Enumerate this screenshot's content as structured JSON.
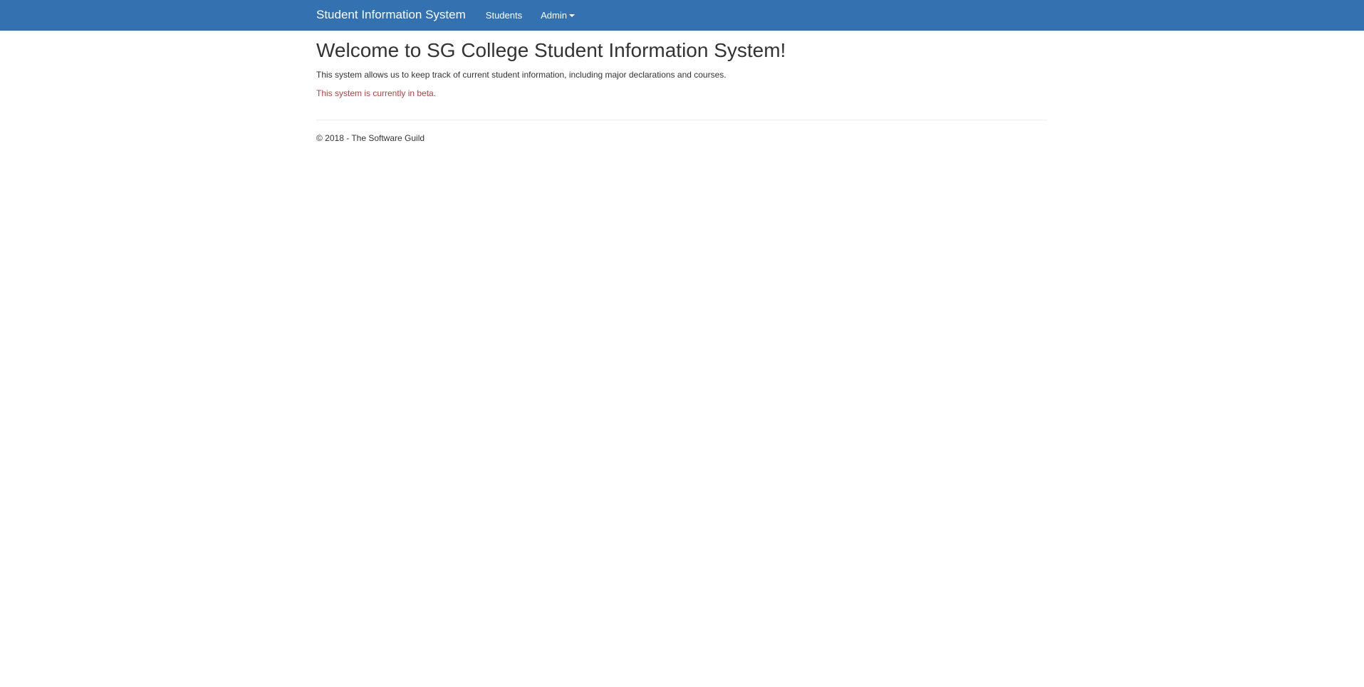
{
  "navbar": {
    "brand": "Student Information System",
    "items": [
      {
        "label": "Students"
      },
      {
        "label": "Admin"
      }
    ],
    "background": "#3371b0"
  },
  "main": {
    "title": "Welcome to SG College Student Information System!",
    "intro": "This system allows us to keep track of current student information, including major declarations and courses.",
    "beta_notice": "This system is currently in beta.",
    "beta_color": "#a94442"
  },
  "footer": {
    "text": "© 2018 - The Software Guild"
  }
}
